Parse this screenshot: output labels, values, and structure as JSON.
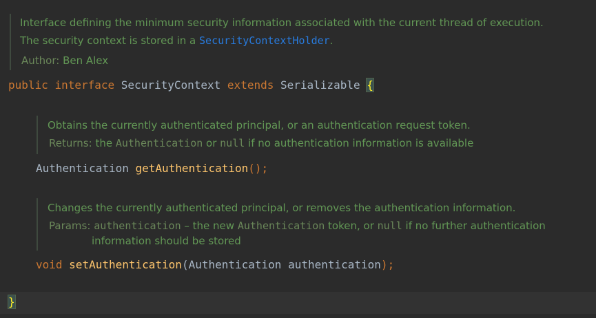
{
  "class_doc": {
    "line1": "Interface defining the minimum security information associated with the current thread of execution.",
    "line2_prefix": "The security context is stored in a ",
    "line2_link": "SecurityContextHolder",
    "line2_suffix": ".",
    "author_label": "Author:",
    "author_name": "Ben Alex"
  },
  "declaration": {
    "kw_public": "public",
    "kw_interface": "interface",
    "name": "SecurityContext",
    "kw_extends": "extends",
    "parent": "Serializable",
    "open_brace": "{"
  },
  "get_doc": {
    "summary": "Obtains the currently authenticated principal, or an authentication request token.",
    "returns_label": "Returns:",
    "returns_pre": "the ",
    "returns_code1": "Authentication",
    "returns_mid": " or ",
    "returns_code2": "null",
    "returns_post": " if no authentication information is available"
  },
  "get_method": {
    "return_type": "Authentication",
    "name": "getAuthentication",
    "suffix": "();"
  },
  "set_doc": {
    "summary": "Changes the currently authenticated principal, or removes the authentication information.",
    "params_label": "Params:",
    "param_name": "authentication",
    "param_dash": " – the new ",
    "param_code1": "Authentication",
    "param_mid": " token, or ",
    "param_code2": "null",
    "param_post": " if no further authentication",
    "param_line2": "information should be stored"
  },
  "set_method": {
    "return_type": "void",
    "name": "setAuthentication",
    "open_paren": "(",
    "param_type": "Authentication",
    "param_name": "authentication",
    "close": ");"
  },
  "closing": {
    "brace": "}"
  },
  "colors": {
    "background": "#2b2b2b",
    "doc_text": "#629755",
    "keyword": "#cc7832",
    "identifier": "#a9b7c6",
    "method": "#ffc66d",
    "link": "#287bde",
    "brace_match": "#ffef28"
  }
}
